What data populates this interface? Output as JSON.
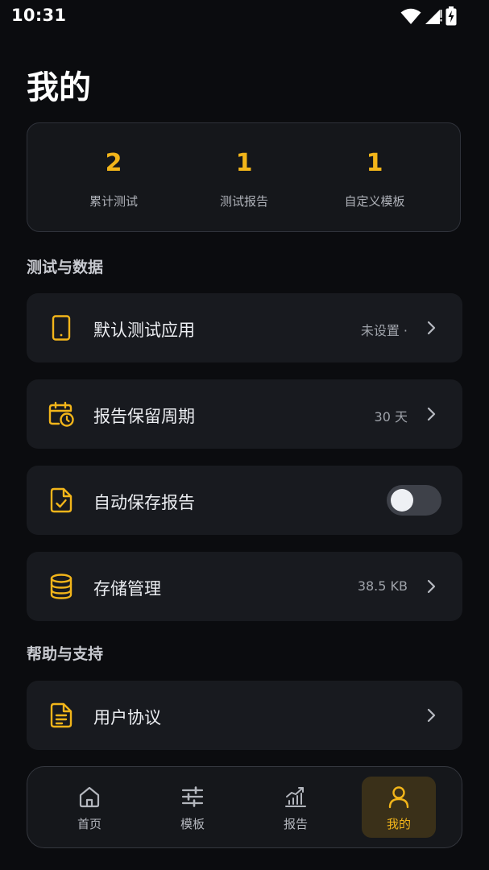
{
  "status_bar": {
    "time": "10:31"
  },
  "page": {
    "title": "我的"
  },
  "stats": [
    {
      "value": "2",
      "label": "累计测试"
    },
    {
      "value": "1",
      "label": "测试报告"
    },
    {
      "value": "1",
      "label": "自定义模板"
    }
  ],
  "sections": {
    "data": {
      "title": "测试与数据",
      "items": [
        {
          "label": "默认测试应用",
          "value": "未设置 ·",
          "icon": "phone-icon"
        },
        {
          "label": "报告保留周期",
          "value": "30 天",
          "icon": "calendar-clock-icon"
        },
        {
          "label": "自动保存报告",
          "toggle_on": false,
          "icon": "file-check-icon"
        },
        {
          "label": "存储管理",
          "value": "38.5 KB",
          "icon": "database-icon"
        }
      ]
    },
    "help": {
      "title": "帮助与支持",
      "items": [
        {
          "label": "用户协议",
          "icon": "document-icon"
        }
      ]
    }
  },
  "bottom_nav": {
    "items": [
      {
        "label": "首页",
        "icon": "home-icon",
        "active": false
      },
      {
        "label": "模板",
        "icon": "sliders-icon",
        "active": false
      },
      {
        "label": "报告",
        "icon": "chart-icon",
        "active": false
      },
      {
        "label": "我的",
        "icon": "user-icon",
        "active": true
      }
    ]
  },
  "colors": {
    "accent": "#f2b51a",
    "background": "#0b0c0f",
    "card": "#181a1f",
    "active_nav_bg": "#3a3019"
  }
}
